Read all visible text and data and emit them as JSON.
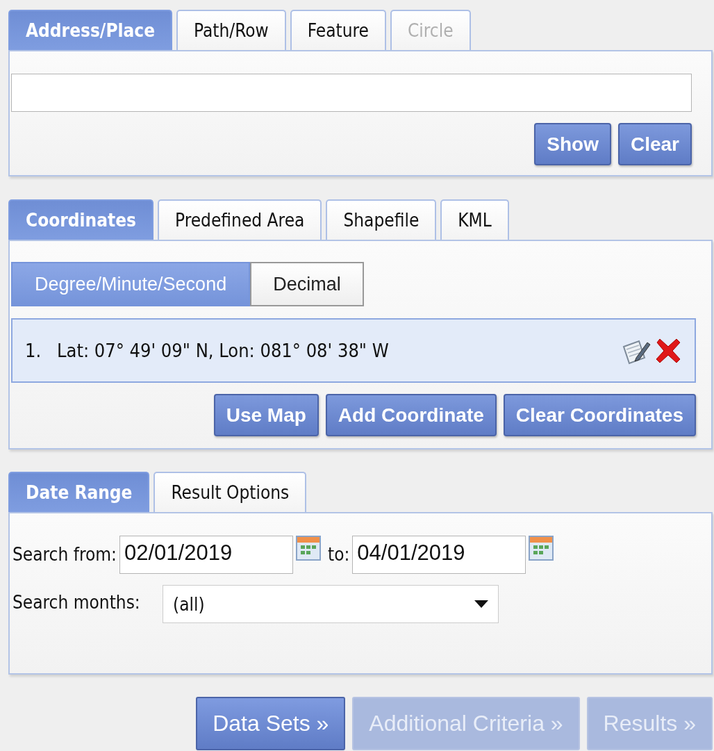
{
  "location_panel": {
    "tabs": [
      {
        "label": "Address/Place",
        "selected": true,
        "disabled": false
      },
      {
        "label": "Path/Row",
        "selected": false,
        "disabled": false
      },
      {
        "label": "Feature",
        "selected": false,
        "disabled": false
      },
      {
        "label": "Circle",
        "selected": false,
        "disabled": true
      }
    ],
    "buttons": [
      "Show",
      "Clear"
    ]
  },
  "area_panel": {
    "tabs": [
      {
        "label": "Coordinates",
        "selected": true,
        "disabled": false
      },
      {
        "label": "Predefined Area",
        "selected": false,
        "disabled": false
      },
      {
        "label": "Shapefile",
        "selected": false,
        "disabled": false
      },
      {
        "label": "KML",
        "selected": false,
        "disabled": false
      }
    ],
    "format_toggle": [
      {
        "label": "Degree/Minute/Second",
        "selected": true
      },
      {
        "label": "Decimal",
        "selected": false
      }
    ],
    "coordinates": [
      {
        "number": "1.",
        "text": "Lat: 07° 49' 09\" N, Lon: 081° 08' 38\" W"
      }
    ],
    "buttons": [
      "Use Map",
      "Add Coordinate",
      "Clear Coordinates"
    ]
  },
  "date_panel": {
    "tabs": [
      {
        "label": "Date Range",
        "selected": true,
        "disabled": false
      },
      {
        "label": "Result Options",
        "selected": false,
        "disabled": false
      }
    ],
    "from_label": "Search from:",
    "from_value": "02/01/2019",
    "to_label": "to:",
    "to_value": "04/01/2019",
    "months_label": "Search months:",
    "months_value": "(all)"
  },
  "nav_buttons": [
    {
      "label": "Data Sets »",
      "disabled": false
    },
    {
      "label": "Additional Criteria »",
      "disabled": true
    },
    {
      "label": "Results »",
      "disabled": true
    }
  ]
}
